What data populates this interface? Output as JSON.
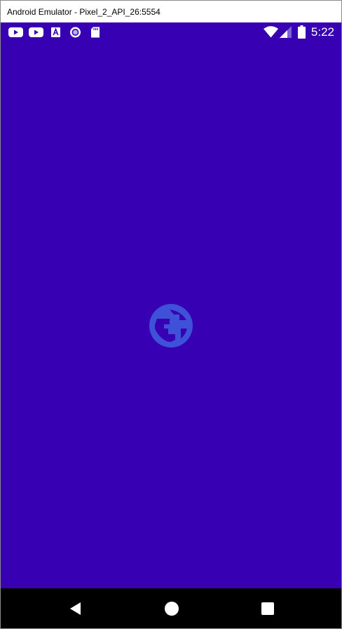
{
  "window": {
    "title": "Android Emulator - Pixel_2_API_26:5554"
  },
  "status_bar": {
    "time": "5:22",
    "notification_icons": [
      "youtube-icon",
      "youtube-icon",
      "font-a-icon",
      "record-icon",
      "sd-card-icon"
    ],
    "system_icons": [
      "wifi-icon",
      "signal-icon",
      "battery-icon"
    ]
  },
  "screen": {
    "background_color": "#3700b3",
    "splash_icon": "globe-icon",
    "splash_icon_color": "#3f51d8"
  },
  "nav_bar": {
    "buttons": [
      "back-icon",
      "home-icon",
      "recents-icon"
    ]
  }
}
